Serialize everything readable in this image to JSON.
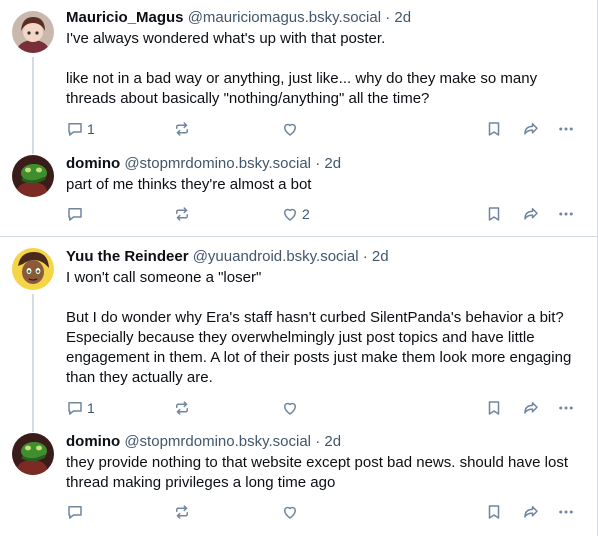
{
  "posts": [
    {
      "name": "Mauricio_Magus",
      "handle": "@mauriciomagus.bsky.social",
      "dot": "·",
      "time": "2d",
      "paragraphs": [
        "I've always wondered what's up with that poster.",
        "like not in a bad way or anything, just like... why do they make so many threads about basically \"nothing/anything\" all the time?"
      ],
      "reply_count": "1",
      "like_count": ""
    },
    {
      "name": "domino",
      "handle": "@stopmrdomino.bsky.social",
      "dot": "·",
      "time": "2d",
      "paragraphs": [
        "part of me thinks they're almost a bot"
      ],
      "reply_count": "",
      "like_count": "2"
    },
    {
      "name": "Yuu the Reindeer",
      "handle": "@yuuandroid.bsky.social",
      "dot": "·",
      "time": "2d",
      "paragraphs": [
        "I won't call someone a \"loser\"",
        "But I do wonder why Era's staff hasn't curbed SilentPanda's behavior a bit? Especially because they overwhelmingly just post topics and have little engagement in them. A lot of their posts just make them look more engaging than they actually are."
      ],
      "reply_count": "1",
      "like_count": ""
    },
    {
      "name": "domino",
      "handle": "@stopmrdomino.bsky.social",
      "dot": "·",
      "time": "2d",
      "paragraphs": [
        "they provide nothing to that website except post bad news. should have lost thread making privileges a long time ago"
      ],
      "reply_count": "",
      "like_count": ""
    }
  ],
  "icons": {
    "reply": "reply-icon",
    "repost": "repost-icon",
    "like": "like-icon",
    "bookmark": "bookmark-icon",
    "share": "share-icon",
    "more": "more-icon"
  },
  "colors": {
    "text": "#0b0f14",
    "muted": "#42576c",
    "icon": "#6f869f",
    "divider": "#d4dbe2"
  }
}
